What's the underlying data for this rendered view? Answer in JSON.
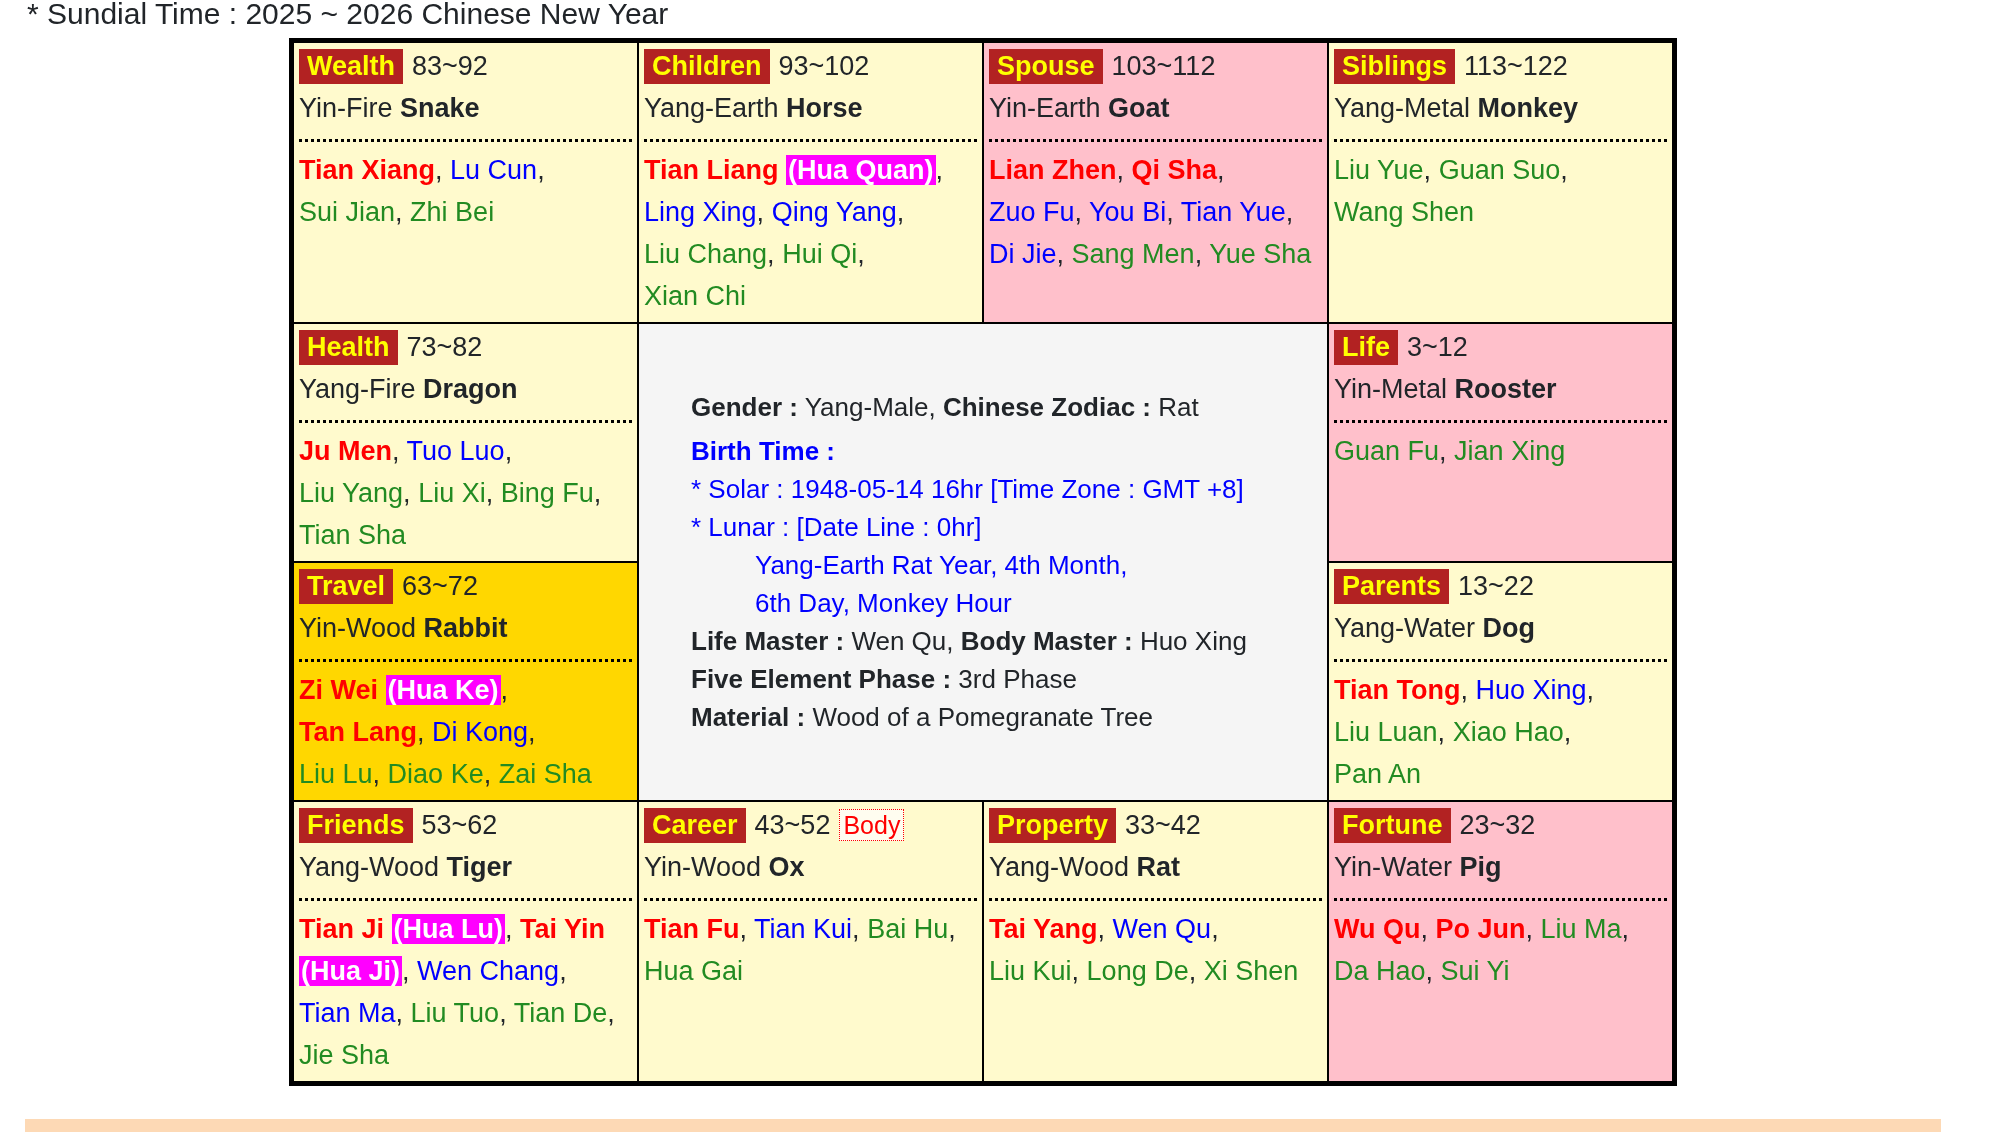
{
  "title": "* Sundial Time : 2025 ~ 2026 Chinese New Year",
  "palaces": [
    {
      "palace": "Wealth",
      "ages": "83~92",
      "sign": "Yin-Fire **Snake**",
      "color": "#fffacd",
      "stars": [
        [
          {
            "text": "Tian Xiang",
            "kind": "major",
            "after": ","
          },
          {
            "text": "Lu Cun",
            "kind": "auxiliary",
            "after": ","
          }
        ],
        [
          {
            "text": "Sui Jian",
            "kind": "minor",
            "after": ","
          },
          {
            "text": "Zhi Bei",
            "kind": "minor"
          }
        ]
      ]
    },
    {
      "palace": "Children",
      "ages": "93~102",
      "sign": "Yang-Earth **Horse**",
      "color": "#fffacd",
      "stars": [
        [
          {
            "text": "Tian Liang",
            "kind": "major"
          },
          {
            "text": "(Hua Quan)",
            "kind": "transformation",
            "after": ","
          }
        ],
        [
          {
            "text": "Ling Xing",
            "kind": "auxiliary",
            "after": ","
          },
          {
            "text": "Qing Yang",
            "kind": "auxiliary",
            "after": ","
          }
        ],
        [
          {
            "text": "Liu Chang",
            "kind": "minor",
            "after": ","
          },
          {
            "text": "Hui Qi",
            "kind": "minor",
            "after": ","
          }
        ],
        [
          {
            "text": "Xian Chi",
            "kind": "minor"
          }
        ]
      ]
    },
    {
      "palace": "Spouse",
      "ages": "103~112",
      "sign": "Yin-Earth **Goat**",
      "color": "#ffc0cb",
      "stars": [
        [
          {
            "text": "Lian Zhen",
            "kind": "major",
            "after": ","
          },
          {
            "text": "Qi Sha",
            "kind": "major",
            "after": ","
          }
        ],
        [
          {
            "text": "Zuo Fu",
            "kind": "auxiliary",
            "after": ","
          },
          {
            "text": "You Bi",
            "kind": "auxiliary",
            "after": ","
          },
          {
            "text": "Tian Yue",
            "kind": "auxiliary",
            "after": ","
          }
        ],
        [
          {
            "text": "Di Jie",
            "kind": "auxiliary",
            "after": ","
          },
          {
            "text": "Sang Men",
            "kind": "minor",
            "after": ","
          },
          {
            "text": "Yue Sha",
            "kind": "minor"
          }
        ]
      ]
    },
    {
      "palace": "Siblings",
      "ages": "113~122",
      "sign": "Yang-Metal **Monkey**",
      "color": "#fffacd",
      "stars": [
        [
          {
            "text": "Liu Yue",
            "kind": "minor",
            "after": ","
          },
          {
            "text": "Guan Suo",
            "kind": "minor",
            "after": ","
          }
        ],
        [
          {
            "text": "Wang Shen",
            "kind": "minor"
          }
        ]
      ]
    },
    {
      "palace": "Health",
      "ages": "73~82",
      "sign": "Yang-Fire **Dragon**",
      "color": "#fffacd",
      "stars": [
        [
          {
            "text": "Ju Men",
            "kind": "major",
            "after": ","
          },
          {
            "text": "Tuo Luo",
            "kind": "auxiliary",
            "after": ","
          }
        ],
        [
          {
            "text": "Liu Yang",
            "kind": "minor",
            "after": ","
          },
          {
            "text": "Liu Xi",
            "kind": "minor",
            "after": ","
          },
          {
            "text": "Bing Fu",
            "kind": "minor",
            "after": ","
          }
        ],
        [
          {
            "text": "Tian Sha",
            "kind": "minor"
          }
        ]
      ]
    },
    {
      "palace": "Life",
      "ages": "3~12",
      "sign": "Yin-Metal **Rooster**",
      "color": "#ffc0cb",
      "stars": [
        [
          {
            "text": "Guan Fu",
            "kind": "minor",
            "after": ","
          },
          {
            "text": "Jian Xing",
            "kind": "minor"
          }
        ]
      ]
    },
    {
      "palace": "Travel",
      "ages": "63~72",
      "sign": "Yin-Wood **Rabbit**",
      "color": "#ffd700",
      "stars": [
        [
          {
            "text": "Zi Wei",
            "kind": "major"
          },
          {
            "text": "(Hua Ke)",
            "kind": "transformation",
            "after": ","
          }
        ],
        [
          {
            "text": "Tan Lang",
            "kind": "major",
            "after": ","
          },
          {
            "text": "Di Kong",
            "kind": "auxiliary",
            "after": ","
          }
        ],
        [
          {
            "text": "Liu Lu",
            "kind": "minor",
            "after": ","
          },
          {
            "text": "Diao Ke",
            "kind": "minor",
            "after": ","
          },
          {
            "text": "Zai Sha",
            "kind": "minor"
          }
        ]
      ]
    },
    {
      "palace": "Parents",
      "ages": "13~22",
      "sign": "Yang-Water **Dog**",
      "color": "#fffacd",
      "stars": [
        [
          {
            "text": "Tian Tong",
            "kind": "major",
            "after": ","
          },
          {
            "text": "Huo Xing",
            "kind": "auxiliary",
            "after": ","
          }
        ],
        [
          {
            "text": "Liu Luan",
            "kind": "minor",
            "after": ","
          },
          {
            "text": "Xiao Hao",
            "kind": "minor",
            "after": ","
          }
        ],
        [
          {
            "text": "Pan An",
            "kind": "minor"
          }
        ]
      ]
    },
    {
      "palace": "Friends",
      "ages": "53~62",
      "sign": "Yang-Wood **Tiger**",
      "color": "#fffacd",
      "stars": [
        [
          {
            "text": "Tian Ji",
            "kind": "major"
          },
          {
            "text": "(Hua Lu)",
            "kind": "transformation",
            "after": ","
          },
          {
            "text": "Tai Yin",
            "kind": "major"
          }
        ],
        [
          {
            "text": "(Hua Ji)",
            "kind": "transformation",
            "after": ","
          },
          {
            "text": "Wen Chang",
            "kind": "auxiliary",
            "after": ","
          }
        ],
        [
          {
            "text": "Tian Ma",
            "kind": "auxiliary",
            "after": ","
          },
          {
            "text": "Liu Tuo",
            "kind": "minor",
            "after": ","
          },
          {
            "text": "Tian De",
            "kind": "minor",
            "after": ","
          }
        ],
        [
          {
            "text": "Jie Sha",
            "kind": "minor"
          }
        ]
      ]
    },
    {
      "palace": "Career",
      "ages": "43~52",
      "body_tag": "Body",
      "sign": "Yin-Wood **Ox**",
      "color": "#fffacd",
      "stars": [
        [
          {
            "text": "Tian Fu",
            "kind": "major",
            "after": ","
          },
          {
            "text": "Tian Kui",
            "kind": "auxiliary",
            "after": ","
          },
          {
            "text": "Bai Hu",
            "kind": "minor",
            "after": ","
          }
        ],
        [
          {
            "text": "Hua Gai",
            "kind": "minor"
          }
        ]
      ]
    },
    {
      "palace": "Property",
      "ages": "33~42",
      "sign": "Yang-Wood **Rat**",
      "color": "#fffacd",
      "stars": [
        [
          {
            "text": "Tai Yang",
            "kind": "major",
            "after": ","
          },
          {
            "text": "Wen Qu",
            "kind": "auxiliary",
            "after": ","
          }
        ],
        [
          {
            "text": "Liu Kui",
            "kind": "minor",
            "after": ","
          },
          {
            "text": "Long De",
            "kind": "minor",
            "after": ","
          },
          {
            "text": "Xi Shen",
            "kind": "minor"
          }
        ]
      ]
    },
    {
      "palace": "Fortune",
      "ages": "23~32",
      "sign": "Yin-Water **Pig**",
      "color": "#ffc0cb",
      "stars": [
        [
          {
            "text": "Wu Qu",
            "kind": "major",
            "after": ","
          },
          {
            "text": "Po Jun",
            "kind": "major",
            "after": ","
          },
          {
            "text": "Liu Ma",
            "kind": "minor",
            "after": ","
          }
        ],
        [
          {
            "text": "Da Hao",
            "kind": "minor",
            "after": ","
          },
          {
            "text": "Sui Yi",
            "kind": "minor"
          }
        ]
      ]
    }
  ],
  "center": {
    "lines": [
      {
        "text": "**Gender :** Yang-Male, **Chinese Zodiac :** Rat",
        "kind": "detail"
      },
      {
        "text": "Birth Time :",
        "kind": "heading"
      },
      {
        "text": "* Solar : 1948-05-14 16hr [Time Zone : GMT +8]",
        "kind": "birth"
      },
      {
        "text": "* Lunar : [Date Line : 0hr]",
        "kind": "birth"
      },
      {
        "text": "Yang-Earth Rat Year, 4th Month,",
        "kind": "birth_sub"
      },
      {
        "text": "6th Day, Monkey Hour",
        "kind": "birth_sub"
      },
      {
        "text": "**Life Master :** Wen Qu, **Body Master :** Huo Xing",
        "kind": "detail"
      },
      {
        "text": "**Five Element Phase :** 3rd Phase",
        "kind": "detail"
      },
      {
        "text": "**Material :** Wood of a Pomegranate Tree",
        "kind": "detail"
      }
    ]
  }
}
